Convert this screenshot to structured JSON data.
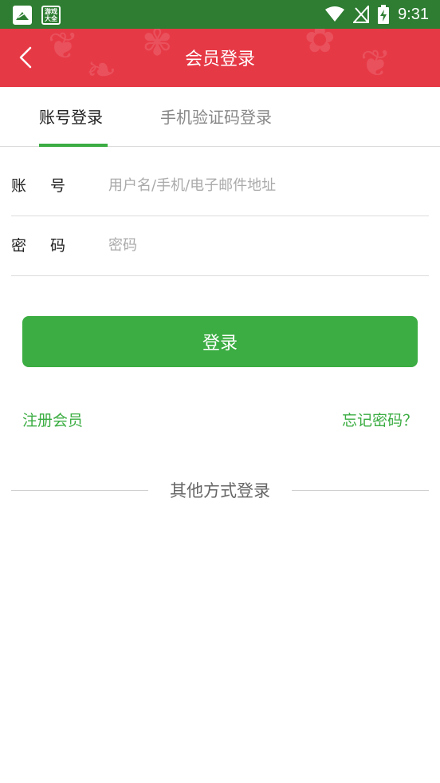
{
  "status_bar": {
    "app_badge_text": "游戏\n大全",
    "time": "9:31"
  },
  "header": {
    "title": "会员登录"
  },
  "tabs": [
    {
      "label": "账号登录",
      "active": true
    },
    {
      "label": "手机验证码登录",
      "active": false
    }
  ],
  "form": {
    "account_label": "账 号",
    "account_value": "",
    "account_placeholder": "用户名/手机/电子邮件地址",
    "password_label": "密 码",
    "password_value": "",
    "password_placeholder": "密码"
  },
  "login_button": "登录",
  "links": {
    "register": "注册会员",
    "forgot": "忘记密码？"
  },
  "other_login": "其他方式登录",
  "colors": {
    "status_bar": "#2e7d32",
    "header": "#e63946",
    "accent_green": "#3bad42"
  },
  "icons": {
    "back": "back-arrow-icon",
    "wifi": "wifi-icon",
    "signal": "no-signal-icon",
    "battery": "battery-charging-icon"
  }
}
